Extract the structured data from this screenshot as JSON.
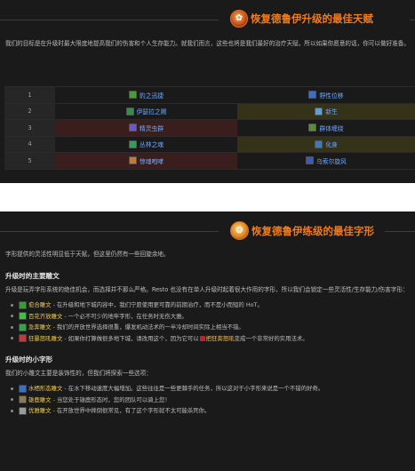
{
  "section1": {
    "title": "恢复德鲁伊升级的最佳天赋",
    "paragraph": "我们的目标是在升级时最大限度地提高我们的伤害和个人生存能力。就我们而言，这些也将是我们最好的治疗天赋，所以如果你愿意的话，你可以做好准备。",
    "table": [
      {
        "level": "1",
        "left": {
          "icon": "paw-icon",
          "label": "豹之迅捷",
          "color": "#4d9a3a"
        },
        "right": {
          "icon": "dash-icon",
          "label": "野性位移",
          "color": "#3a6fc2"
        },
        "left_hl": false,
        "right_hl": false
      },
      {
        "level": "2",
        "left": {
          "icon": "tree-icon",
          "label": "伊瑟拉之赐",
          "color": "#3b8a4a"
        },
        "right": {
          "icon": "sprout-icon",
          "label": "新生",
          "color": "#5aa0d8"
        },
        "left_hl": false,
        "right_hl": "olive"
      },
      {
        "level": "3",
        "left": {
          "icon": "fairy-icon",
          "label": "精灵虫群",
          "color": "#6b5ac2"
        },
        "right": {
          "icon": "roots-icon",
          "label": "群体缠绕",
          "color": "#5a8a3a"
        },
        "left_hl": "red",
        "right_hl": false
      },
      {
        "level": "4",
        "left": {
          "icon": "soul-icon",
          "label": "丛林之魂",
          "color": "#3a9a5a"
        },
        "right": {
          "icon": "flame-icon",
          "label": "化身",
          "color": "#3a7ac2"
        },
        "left_hl": false,
        "right_hl": "olive"
      },
      {
        "level": "5",
        "left": {
          "icon": "roar-icon",
          "label": "惊魂咆哮",
          "color": "#c27a3a"
        },
        "right": {
          "icon": "vortex-icon",
          "label": "乌索尔旋风",
          "color": "#3a5ac2"
        },
        "left_hl": "red",
        "right_hl": false
      }
    ]
  },
  "section2": {
    "title": "恢复德鲁伊练级的最佳字形",
    "intro": "字形提供的灵活性明显低于天赋，但这里仍然有一些回旋余地。",
    "major_heading": "升级时的主要雕文",
    "major_para": "升级是玩弄字形系统的绝佳机会，而选择并不那么严格。Resto 也没有在单人升级时起着很大作用的字形，所以我们会锁定一些灵活性/生存能力/伤害字形：",
    "major": [
      {
        "icon": "leaf-icon",
        "icolor": "#3a9a3a",
        "name": "愈合雕文",
        "text": " - 在升级和地下城内容中，我们宁愿使用更可靠的前期治疗，而不是小而短的 HoT。",
        "extra": null
      },
      {
        "icon": "flower-icon",
        "icolor": "#4ab84a",
        "name": "百花齐放雕文",
        "text": " - 一个必不可少的地牢字形，在任务时无伤大雅。",
        "extra": null
      },
      {
        "icon": "swift-icon",
        "icolor": "#3aa04a",
        "name": "急奔雕文",
        "text": " - 我们的开放世界选择很重，爆发机动法术的一半冷却时间实际上相当不错。",
        "extra": null
      },
      {
        "icon": "claw-icon",
        "icolor": "#c23a3a",
        "name": "狂暴怒吼雕文",
        "text": " - 如果你打算做很多地下城，请改用这个，因为它可以",
        "extra": {
          "name": "把狂奔怒吼",
          "rest": "变成一个非常好的实用法术。"
        }
      }
    ],
    "minor_heading": "升级时的小字形",
    "minor_para": "我们的小雕文主要是装饰性的，但我们将探索一些选项：",
    "minor": [
      {
        "icon": "water-icon",
        "icolor": "#3a6fc2",
        "name": "水栖形态雕文",
        "text": " - 在水下移动速度大幅增加。这些往往是一些更棘手的任务，所以这对于小字形来说是一个不错的好奇。"
      },
      {
        "icon": "stag-icon",
        "icolor": "#8a7a5a",
        "name": "雄鹿雕文",
        "text": " - 当您处于雄鹿形态时，您的团队可以骑上您！"
      },
      {
        "icon": "grace-icon",
        "icolor": "#9a9a9a",
        "name": "优雅雕文",
        "text": " - 在开放世界中摔倒很常见，有了这个字形就不太可能杀死你。"
      }
    ]
  }
}
